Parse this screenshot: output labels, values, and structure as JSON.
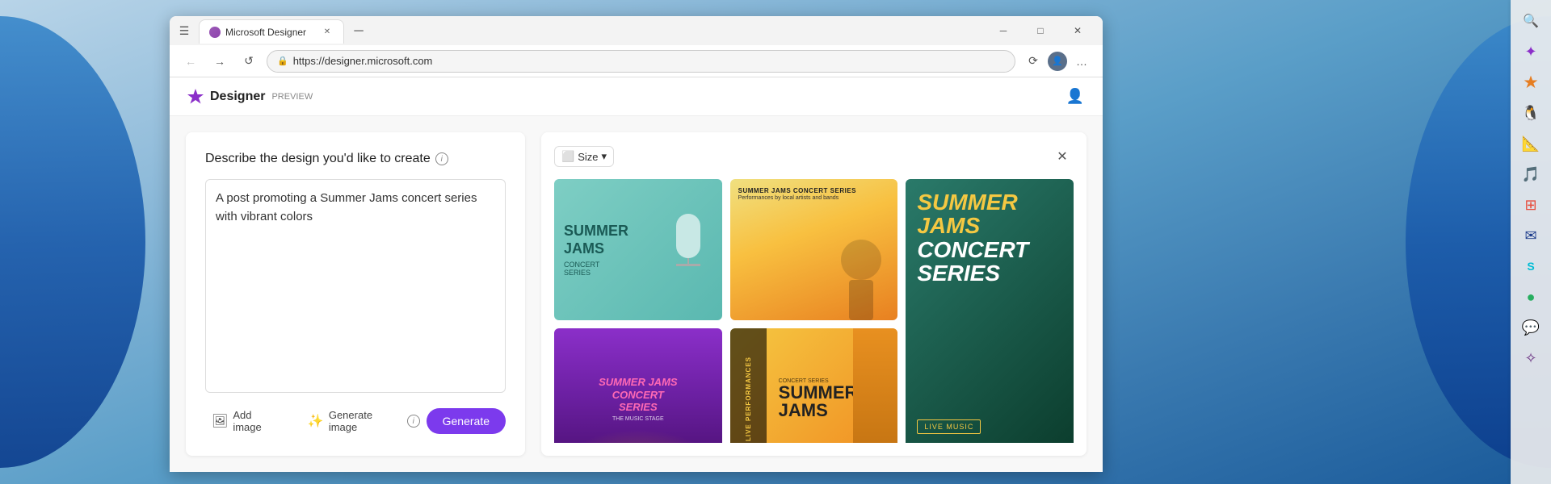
{
  "desktop": {
    "background": "Windows desktop with blue abstract shapes"
  },
  "browser": {
    "tab": {
      "label": "Microsoft Designer",
      "favicon_alt": "purple circle"
    },
    "new_tab_icon": "+",
    "controls": {
      "minimize": "─",
      "maximize": "□",
      "close": "✕"
    },
    "nav": {
      "back": "←",
      "forward": "→",
      "refresh": "↺"
    },
    "url": "https://designer.microsoft.com",
    "extensions": [
      "⟳",
      "✦",
      "🎨",
      "🐧",
      "📐",
      "🎵",
      "⊞",
      "✉",
      "S",
      "💬",
      "🔮"
    ],
    "menu_dots": "…"
  },
  "designer": {
    "logo_alt": "purple star icon",
    "name": "Designer",
    "preview_label": "PREVIEW",
    "profile_icon": "person",
    "left_panel": {
      "title": "Describe the design you'd like to create",
      "info_icon": "i",
      "textarea_value": "A post promoting a Summer Jams concert series with vibrant colors",
      "add_image_label": "Add image",
      "generate_image_label": "Generate image",
      "generate_info_icon": "i",
      "generate_btn_label": "Generate"
    },
    "right_panel": {
      "size_label": "Size",
      "close_icon": "✕",
      "designs": [
        {
          "id": 1,
          "type": "teal-mic",
          "title": "SUMMER\nJAMS",
          "subtitle": "CONCERT\nSERIES",
          "sub2": ""
        },
        {
          "id": 2,
          "type": "yellow-performer",
          "title": "SUMMER JAMS CONCERT SERIES",
          "subtitle": "Performances by local artists and bands"
        },
        {
          "id": 3,
          "type": "big-green",
          "title": "SUMMER\nJAMS\nCONCERT\nSERIES",
          "subtitle": "LIVE MUSIC"
        },
        {
          "id": 4,
          "type": "purple-concert",
          "title": "SUMMER JAMS\nCONCERT\nSERIES",
          "subtitle": "THE MUSIC STAGE"
        },
        {
          "id": 5,
          "type": "yellow-headphones",
          "vertical_text": "LIVE PERFORMANCES",
          "concert_label": "CONCERT SERIES",
          "jams_title": "SUMMER\nJAMS"
        }
      ]
    }
  },
  "windows_sidebar": {
    "icons": [
      {
        "name": "search",
        "symbol": "🔍",
        "color": "#333"
      },
      {
        "name": "copilot",
        "symbol": "✦",
        "color": "#8b2fc9"
      },
      {
        "name": "edge",
        "symbol": "◎",
        "color": "#0078d4"
      },
      {
        "name": "teams",
        "symbol": "⬡",
        "color": "#5558af"
      },
      {
        "name": "paint",
        "symbol": "✏",
        "color": "#e67e22"
      },
      {
        "name": "music",
        "symbol": "♪",
        "color": "#e91e63"
      },
      {
        "name": "office",
        "symbol": "⊞",
        "color": "#d63031"
      },
      {
        "name": "outlook",
        "symbol": "✉",
        "color": "#0078d4"
      },
      {
        "name": "skype",
        "symbol": "S",
        "color": "#00aff0"
      },
      {
        "name": "spotify",
        "symbol": "●",
        "color": "#1db954"
      },
      {
        "name": "messenger",
        "symbol": "💬",
        "color": "#0084ff"
      },
      {
        "name": "app12",
        "symbol": "✧",
        "color": "#6c3483"
      }
    ]
  }
}
